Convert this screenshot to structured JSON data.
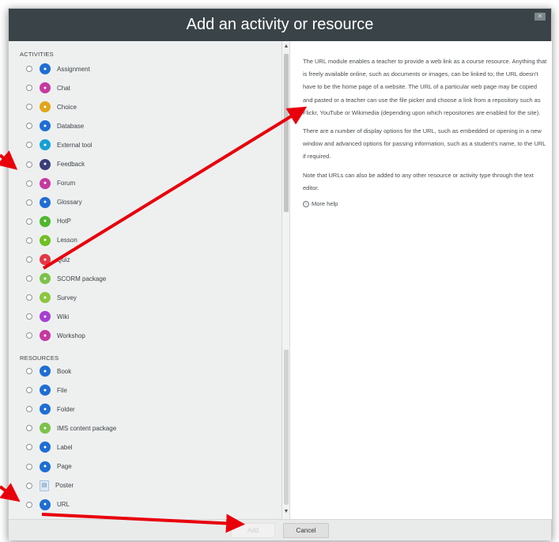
{
  "dialog": {
    "title": "Add an activity or resource",
    "close_icon": "close-icon"
  },
  "activities": {
    "heading": "ACTIVITIES",
    "items": [
      {
        "label": "Assignment",
        "icon": "assignment-icon",
        "color": "#1f6ed4"
      },
      {
        "label": "Chat",
        "icon": "chat-icon",
        "color": "#c53aa0"
      },
      {
        "label": "Choice",
        "icon": "choice-icon",
        "color": "#e0a51c"
      },
      {
        "label": "Database",
        "icon": "database-icon",
        "color": "#1f6ed4"
      },
      {
        "label": "External tool",
        "icon": "external-tool-icon",
        "color": "#17a0d4"
      },
      {
        "label": "Feedback",
        "icon": "feedback-icon",
        "color": "#3c3e7a"
      },
      {
        "label": "Forum",
        "icon": "forum-icon",
        "color": "#c53aa0"
      },
      {
        "label": "Glossary",
        "icon": "glossary-icon",
        "color": "#1f6ed4"
      },
      {
        "label": "HotP",
        "icon": "hotpot-icon",
        "color": "#4fb82d"
      },
      {
        "label": "Lesson",
        "icon": "lesson-icon",
        "color": "#6fc022"
      },
      {
        "label": "Quiz",
        "icon": "quiz-icon",
        "color": "#e53744"
      },
      {
        "label": "SCORM package",
        "icon": "scorm-icon",
        "color": "#7cc24a"
      },
      {
        "label": "Survey",
        "icon": "survey-icon",
        "color": "#8cc63e"
      },
      {
        "label": "Wiki",
        "icon": "wiki-icon",
        "color": "#a63fd1"
      },
      {
        "label": "Workshop",
        "icon": "workshop-icon",
        "color": "#c53aa0"
      }
    ]
  },
  "resources": {
    "heading": "RESOURCES",
    "items": [
      {
        "label": "Book",
        "icon": "book-icon",
        "color": "#1f6ed4"
      },
      {
        "label": "File",
        "icon": "file-icon",
        "color": "#1f6ed4"
      },
      {
        "label": "Folder",
        "icon": "folder-icon",
        "color": "#1f6ed4"
      },
      {
        "label": "IMS content package",
        "icon": "ims-package-icon",
        "color": "#7cc24a"
      },
      {
        "label": "Label",
        "icon": "label-icon",
        "color": "#1f6ed4"
      },
      {
        "label": "Page",
        "icon": "page-icon",
        "color": "#1f6ed4"
      },
      {
        "label": "Poster",
        "icon": "poster-icon",
        "color": "#dbe9f6"
      },
      {
        "label": "URL",
        "icon": "url-icon",
        "color": "#1f6ed4"
      }
    ]
  },
  "help": {
    "paragraphs": [
      "The URL module enables a teacher to provide a web link as a course resource. Anything that is freely available online, such as documents or images, can be linked to; the URL doesn't have to be the home page of a website. The URL of a particular web page may be copied and pasted or a teacher can use the file picker and choose a link from a repository such as Flickr, YouTube or Wikimedia (depending upon which repositories are enabled for the site).",
      "There are a number of display options for the URL, such as embedded or opening in a new window and advanced options for passing information, such as a student's name, to the URL if required.",
      "Note that URLs can also be added to any other resource or activity type through the text editor."
    ],
    "more_help": "More help"
  },
  "footer": {
    "add_label": "Add",
    "cancel_label": "Cancel"
  },
  "colors": {
    "header_bg": "#3a4448",
    "pane_bg": "#eef0f0",
    "annotation_arrow": "#e8000b"
  }
}
